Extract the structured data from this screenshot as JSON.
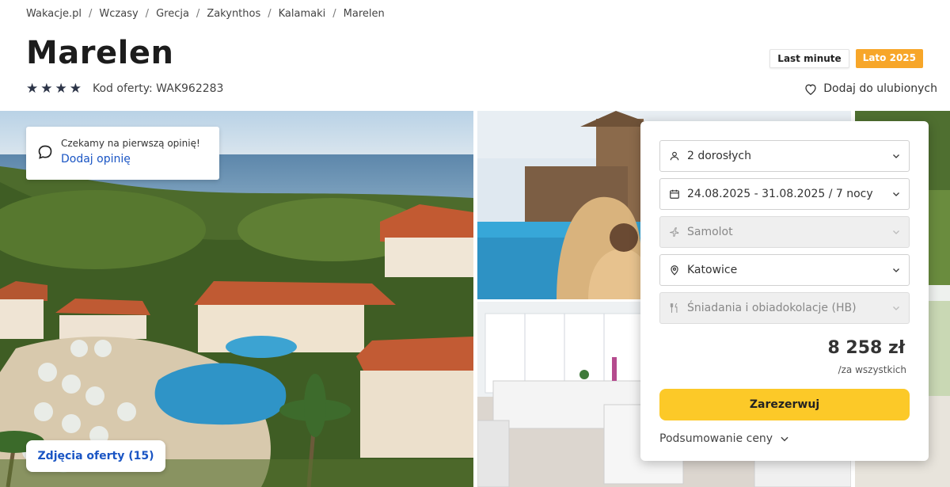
{
  "breadcrumb": [
    "Wakacje.pl",
    "Wczasy",
    "Grecja",
    "Zakynthos",
    "Kalamaki",
    "Marelen"
  ],
  "hotel": {
    "name": "Marelen",
    "stars": 4,
    "offer_code": "Kod oferty: WAK962283"
  },
  "badges": {
    "last_minute": "Last minute",
    "season": "Lato 2025"
  },
  "favorites_label": "Dodaj do ulubionych",
  "review": {
    "prompt": "Czekamy na pierwszą opinię!",
    "add_label": "Dodaj opinię"
  },
  "photos_button": "Zdjęcia oferty (15)",
  "booking": {
    "guests": "2 dorosłych",
    "dates": "24.08.2025 - 31.08.2025 / 7 nocy",
    "transport": "Samolot",
    "departure": "Katowice",
    "board": "Śniadania i obiadokolacje (HB)",
    "price": "8 258 zł",
    "price_note": "/za wszystkich",
    "book_label": "Zarezerwuj",
    "summary_label": "Podsumowanie ceny"
  },
  "colors": {
    "accent_blue": "#1a55c4",
    "book_yellow": "#fcc928",
    "season_orange": "#f7a629",
    "star_navy": "#2c3447"
  }
}
